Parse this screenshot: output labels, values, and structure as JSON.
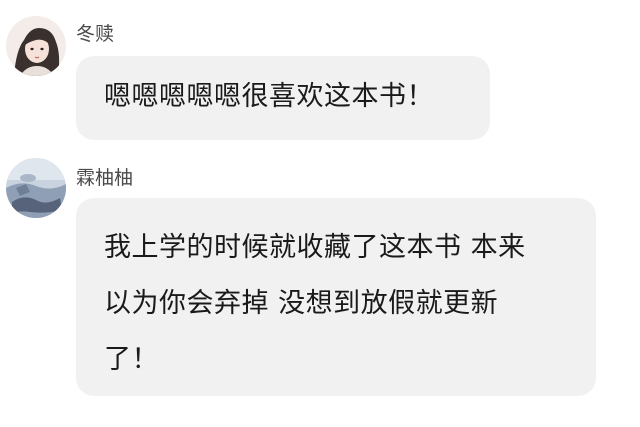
{
  "messages": [
    {
      "username": "冬赎",
      "avatar_icon": "avatar-girl-illustration",
      "text": "嗯嗯嗯嗯嗯很喜欢这本书！"
    },
    {
      "username": "霖柚柚",
      "avatar_icon": "avatar-photo",
      "text": "我上学的时候就收藏了这本书 本来\n以为你会弃掉 没想到放假就更新\n了！"
    }
  ],
  "colors": {
    "background": "#ffffff",
    "bubble": "#f1f1f2",
    "username": "#4a4a4a",
    "text": "#1a1a1a"
  }
}
